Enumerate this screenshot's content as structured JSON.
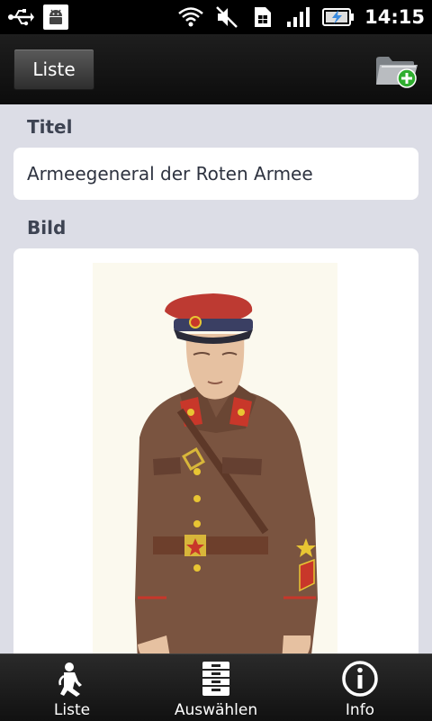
{
  "status_bar": {
    "time": "14:15",
    "icons": [
      "usb-icon",
      "android-debug-icon",
      "wifi-icon",
      "mute-icon",
      "sim-icon",
      "signal-icon",
      "battery-charging-icon"
    ]
  },
  "action_bar": {
    "liste_label": "Liste",
    "add_folder_icon": "folder-add-icon"
  },
  "form": {
    "title_label": "Titel",
    "title_value": "Armeegeneral der Roten Armee",
    "image_label": "Bild",
    "image_subject": "uniform-illustration"
  },
  "tabs": [
    {
      "label": "Liste",
      "icon": "figure-icon"
    },
    {
      "label": "Auswählen",
      "icon": "cabinet-icon"
    },
    {
      "label": "Info",
      "icon": "info-icon"
    }
  ],
  "colors": {
    "background": "#dcdde6",
    "label_text": "#3d4352",
    "add_badge": "#2fae2f"
  }
}
